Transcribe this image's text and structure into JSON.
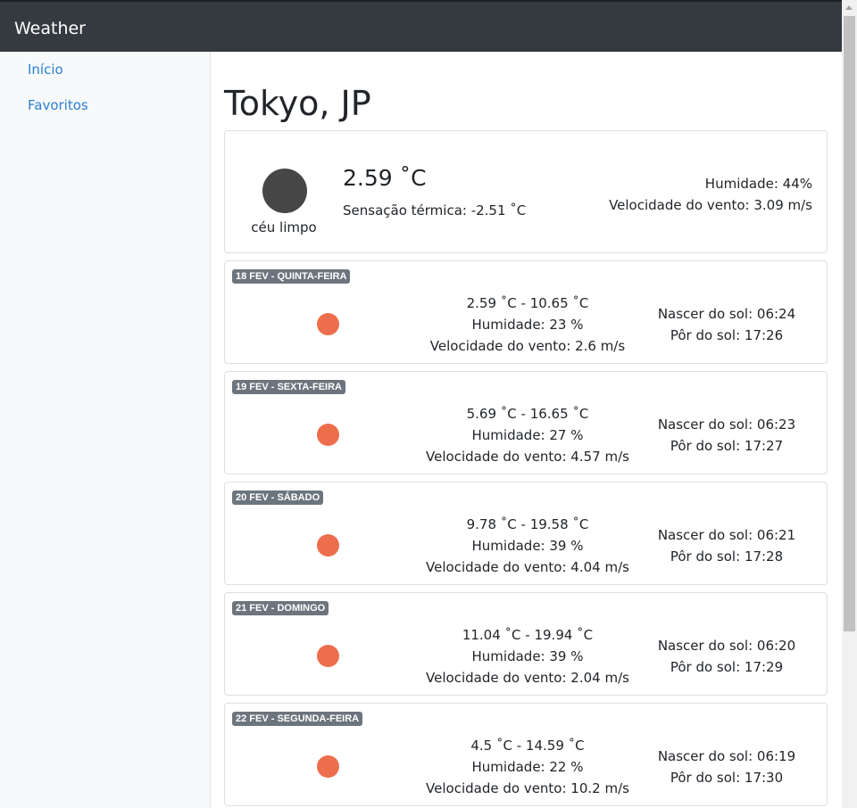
{
  "app": {
    "brand": "Weather"
  },
  "sidebar": {
    "items": [
      {
        "label": "Início"
      },
      {
        "label": "Favoritos"
      }
    ]
  },
  "city": {
    "title": "Tokyo, JP"
  },
  "current": {
    "temp": "2.59 ˚C",
    "feels_like": "Sensação térmica: -2.51 ˚C",
    "condition": "céu limpo",
    "humidity": "Humidade: 44%",
    "wind": "Velocidade do vento: 3.09 m/s",
    "icon": "clear-sky-icon",
    "icon_color": "#464646"
  },
  "forecast": [
    {
      "date": "18 FEV - QUINTA-FEIRA",
      "temp_range": "2.59 ˚C - 10.65 ˚C",
      "humidity": "Humidade: 23 %",
      "wind": "Velocidade do vento: 2.6 m/s",
      "sunrise": "Nascer do sol: 06:24",
      "sunset": "Pôr do sol: 17:26",
      "icon": "sun-icon"
    },
    {
      "date": "19 FEV - SEXTA-FEIRA",
      "temp_range": "5.69 ˚C - 16.65 ˚C",
      "humidity": "Humidade: 27 %",
      "wind": "Velocidade do vento: 4.57 m/s",
      "sunrise": "Nascer do sol: 06:23",
      "sunset": "Pôr do sol: 17:27",
      "icon": "sun-icon"
    },
    {
      "date": "20 FEV - SÁBADO",
      "temp_range": "9.78 ˚C - 19.58 ˚C",
      "humidity": "Humidade: 39 %",
      "wind": "Velocidade do vento: 4.04 m/s",
      "sunrise": "Nascer do sol: 06:21",
      "sunset": "Pôr do sol: 17:28",
      "icon": "sun-icon"
    },
    {
      "date": "21 FEV - DOMINGO",
      "temp_range": "11.04 ˚C - 19.94 ˚C",
      "humidity": "Humidade: 39 %",
      "wind": "Velocidade do vento: 2.04 m/s",
      "sunrise": "Nascer do sol: 06:20",
      "sunset": "Pôr do sol: 17:29",
      "icon": "sun-icon"
    },
    {
      "date": "22 FEV - SEGUNDA-FEIRA",
      "temp_range": "4.5 ˚C - 14.59 ˚C",
      "humidity": "Humidade: 22 %",
      "wind": "Velocidade do vento: 10.2 m/s",
      "sunrise": "Nascer do sol: 06:19",
      "sunset": "Pôr do sol: 17:30",
      "icon": "sun-icon"
    }
  ],
  "colors": {
    "navbar": "#343a40",
    "link": "#2a7fd4",
    "badge": "#6c757d",
    "sun": "#ec6e4c"
  }
}
